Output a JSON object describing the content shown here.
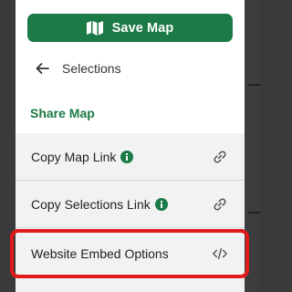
{
  "toolbar": {
    "save_label": "Save Map",
    "save_icon": "map-icon"
  },
  "nav": {
    "back_label": "Selections",
    "back_icon": "arrow-left-icon"
  },
  "share": {
    "title": "Share Map",
    "items": [
      {
        "label": "Copy Map Link",
        "info": true,
        "right_icon": "link-icon"
      },
      {
        "label": "Copy Selections Link",
        "info": true,
        "right_icon": "link-icon"
      },
      {
        "label": "Website Embed Options",
        "info": false,
        "right_icon": "code-icon"
      }
    ]
  },
  "colors": {
    "accent": "#1b7a45",
    "highlight": "#e01b1b",
    "item_bg": "#f2f2f2"
  }
}
